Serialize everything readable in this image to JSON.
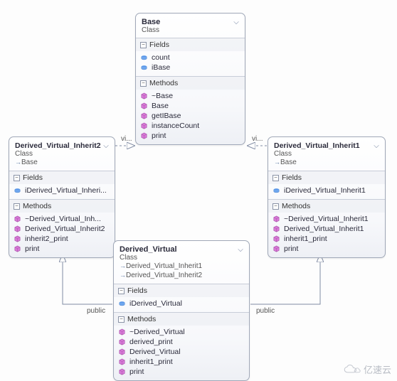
{
  "classes": {
    "base": {
      "title": "Base",
      "kind": "Class",
      "fields_header": "Fields",
      "methods_header": "Methods",
      "fields": [
        {
          "name": "count",
          "icon": "field"
        },
        {
          "name": "iBase",
          "icon": "field"
        }
      ],
      "methods": [
        {
          "name": "~Base",
          "icon": "method"
        },
        {
          "name": "Base",
          "icon": "method"
        },
        {
          "name": "getIBase",
          "icon": "method"
        },
        {
          "name": "instanceCount",
          "icon": "method"
        },
        {
          "name": "print",
          "icon": "method"
        }
      ]
    },
    "inh2": {
      "title": "Derived_Virtual_Inherit2",
      "kind": "Class",
      "inherits": [
        "Base"
      ],
      "fields_header": "Fields",
      "methods_header": "Methods",
      "fields": [
        {
          "name": "iDerived_Virtual_Inheri...",
          "icon": "field"
        }
      ],
      "methods": [
        {
          "name": "~Derived_Virtual_Inh...",
          "icon": "method"
        },
        {
          "name": "Derived_Virtual_Inherit2",
          "icon": "method"
        },
        {
          "name": "inherit2_print",
          "icon": "method"
        },
        {
          "name": "print",
          "icon": "method"
        }
      ]
    },
    "inh1": {
      "title": "Derived_Virtual_Inherit1",
      "kind": "Class",
      "inherits": [
        "Base"
      ],
      "fields_header": "Fields",
      "methods_header": "Methods",
      "fields": [
        {
          "name": "iDerived_Virtual_Inherit1",
          "icon": "field"
        }
      ],
      "methods": [
        {
          "name": "~Derived_Virtual_Inherit1",
          "icon": "method"
        },
        {
          "name": "Derived_Virtual_Inherit1",
          "icon": "method"
        },
        {
          "name": "inherit1_print",
          "icon": "method"
        },
        {
          "name": "print",
          "icon": "method"
        }
      ]
    },
    "dv": {
      "title": "Derived_Virtual",
      "kind": "Class",
      "inherits": [
        "Derived_Virtual_Inherit1",
        "Derived_Virtual_Inherit2"
      ],
      "fields_header": "Fields",
      "methods_header": "Methods",
      "fields": [
        {
          "name": "iDerived_Virtual",
          "icon": "field"
        }
      ],
      "methods": [
        {
          "name": "~Derived_Virtual",
          "icon": "method"
        },
        {
          "name": "derived_print",
          "icon": "method"
        },
        {
          "name": "Derived_Virtual",
          "icon": "method"
        },
        {
          "name": "inherit1_print",
          "icon": "method"
        },
        {
          "name": "print",
          "icon": "method"
        }
      ]
    }
  },
  "connectors": {
    "base_to_inh2_label": "vi...",
    "base_to_inh1_label": "vi...",
    "dv_to_inh2_label": "public",
    "dv_to_inh1_label": "public"
  },
  "watermark": "亿速云",
  "style": {
    "line_color": "#7f8aa2",
    "arrow_color": "#7f8aa2"
  }
}
